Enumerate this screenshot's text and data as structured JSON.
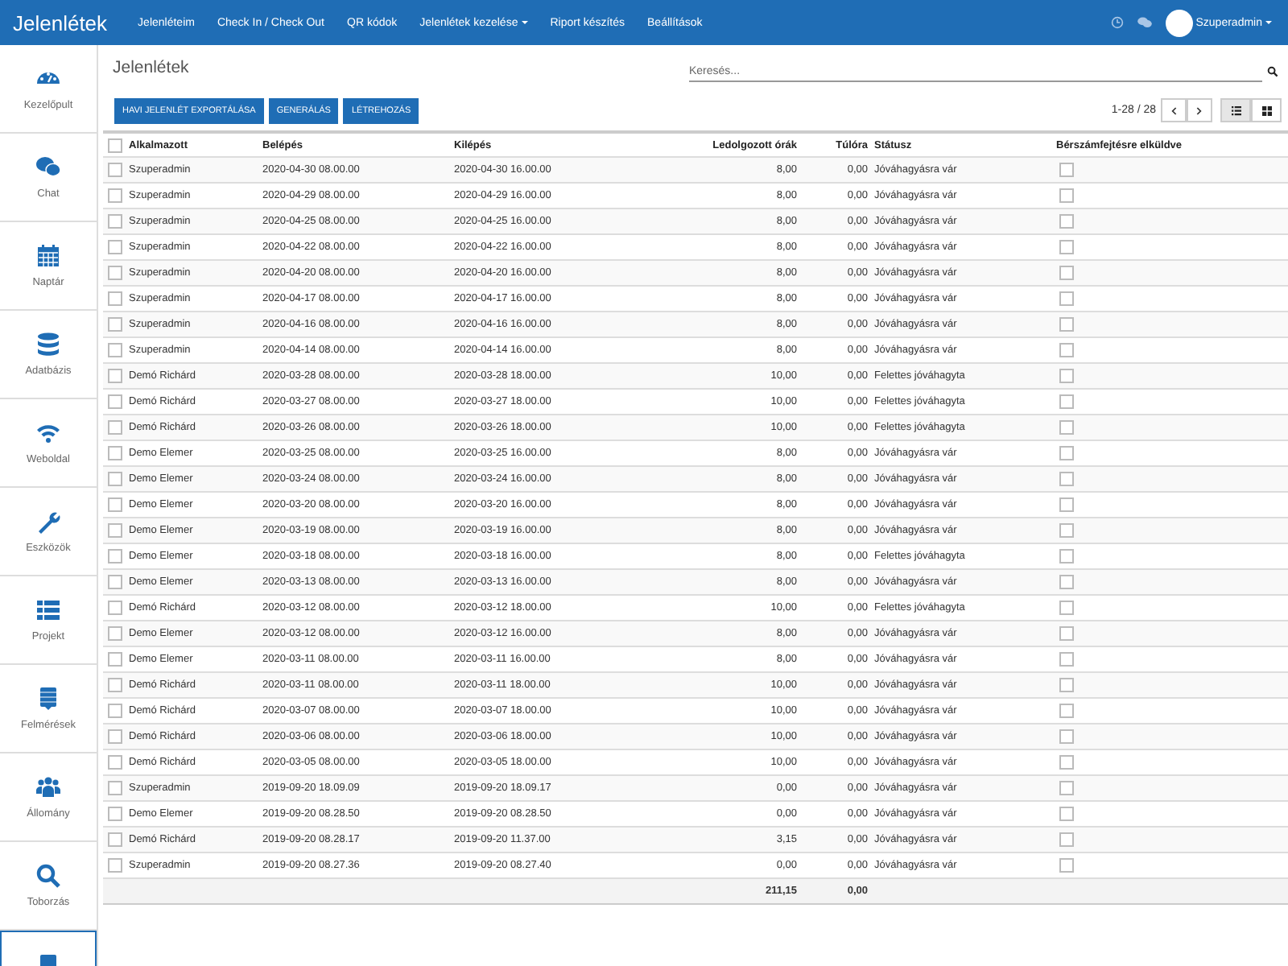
{
  "navbar": {
    "brand": "Jelenlétek",
    "menu": [
      {
        "label": "Jelenléteim",
        "dropdown": false
      },
      {
        "label": "Check In / Check Out",
        "dropdown": false
      },
      {
        "label": "QR kódok",
        "dropdown": false
      },
      {
        "label": "Jelenlétek kezelése",
        "dropdown": true
      },
      {
        "label": "Riport készítés",
        "dropdown": false
      },
      {
        "label": "Beállítások",
        "dropdown": false
      }
    ],
    "user": {
      "name": "Szuperadmin",
      "dropdown": true
    }
  },
  "sidebar": {
    "items": [
      {
        "label": "Kezelőpult",
        "selected": false
      },
      {
        "label": "Chat",
        "selected": false
      },
      {
        "label": "Naptár",
        "selected": false
      },
      {
        "label": "Adatbázis",
        "selected": false
      },
      {
        "label": "Weboldal",
        "selected": false
      },
      {
        "label": "Eszközök",
        "selected": false
      },
      {
        "label": "Projekt",
        "selected": false
      },
      {
        "label": "Felmérések",
        "selected": false
      },
      {
        "label": "Állomány",
        "selected": false
      },
      {
        "label": "Toborzás",
        "selected": false
      },
      {
        "selected": true
      }
    ]
  },
  "page": {
    "title": "Jelenlétek",
    "search": {
      "placeholder": "Keresés..."
    },
    "buttons": [
      "HAVI JELENLÉT EXPORTÁLÁSA",
      "GENERÁLÁS",
      "LÉTREHOZÁS"
    ],
    "pager": {
      "range": "1-28 / 28"
    },
    "view_modes": [
      {
        "selected": true
      },
      {
        "selected": false
      }
    ]
  },
  "table": {
    "select_all": {
      "checked": false
    },
    "columns": [
      "Alkalmazott",
      "Belépés",
      "Kilépés",
      "Ledolgozott órák",
      "Túlóra",
      "Státusz",
      "Bérszámfejtésre elküldve"
    ],
    "rows": [
      {
        "checked": false,
        "employee": "Szuperadmin",
        "check_in": "2020-04-30 08.00.00",
        "check_out": "2020-04-30 16.00.00",
        "hours": "8,00",
        "overtime": "0,00",
        "status": "Jóváhagyásra vár",
        "sent": false
      },
      {
        "checked": false,
        "employee": "Szuperadmin",
        "check_in": "2020-04-29 08.00.00",
        "check_out": "2020-04-29 16.00.00",
        "hours": "8,00",
        "overtime": "0,00",
        "status": "Jóváhagyásra vár",
        "sent": false
      },
      {
        "checked": false,
        "employee": "Szuperadmin",
        "check_in": "2020-04-25 08.00.00",
        "check_out": "2020-04-25 16.00.00",
        "hours": "8,00",
        "overtime": "0,00",
        "status": "Jóváhagyásra vár",
        "sent": false
      },
      {
        "checked": false,
        "employee": "Szuperadmin",
        "check_in": "2020-04-22 08.00.00",
        "check_out": "2020-04-22 16.00.00",
        "hours": "8,00",
        "overtime": "0,00",
        "status": "Jóváhagyásra vár",
        "sent": false
      },
      {
        "checked": false,
        "employee": "Szuperadmin",
        "check_in": "2020-04-20 08.00.00",
        "check_out": "2020-04-20 16.00.00",
        "hours": "8,00",
        "overtime": "0,00",
        "status": "Jóváhagyásra vár",
        "sent": false
      },
      {
        "checked": false,
        "employee": "Szuperadmin",
        "check_in": "2020-04-17 08.00.00",
        "check_out": "2020-04-17 16.00.00",
        "hours": "8,00",
        "overtime": "0,00",
        "status": "Jóváhagyásra vár",
        "sent": false
      },
      {
        "checked": false,
        "employee": "Szuperadmin",
        "check_in": "2020-04-16 08.00.00",
        "check_out": "2020-04-16 16.00.00",
        "hours": "8,00",
        "overtime": "0,00",
        "status": "Jóváhagyásra vár",
        "sent": false
      },
      {
        "checked": false,
        "employee": "Szuperadmin",
        "check_in": "2020-04-14 08.00.00",
        "check_out": "2020-04-14 16.00.00",
        "hours": "8,00",
        "overtime": "0,00",
        "status": "Jóváhagyásra vár",
        "sent": false
      },
      {
        "checked": false,
        "employee": "Demó Richárd",
        "check_in": "2020-03-28 08.00.00",
        "check_out": "2020-03-28 18.00.00",
        "hours": "10,00",
        "overtime": "0,00",
        "status": "Felettes jóváhagyta",
        "sent": false
      },
      {
        "checked": false,
        "employee": "Demó Richárd",
        "check_in": "2020-03-27 08.00.00",
        "check_out": "2020-03-27 18.00.00",
        "hours": "10,00",
        "overtime": "0,00",
        "status": "Felettes jóváhagyta",
        "sent": false
      },
      {
        "checked": false,
        "employee": "Demó Richárd",
        "check_in": "2020-03-26 08.00.00",
        "check_out": "2020-03-26 18.00.00",
        "hours": "10,00",
        "overtime": "0,00",
        "status": "Felettes jóváhagyta",
        "sent": false
      },
      {
        "checked": false,
        "employee": "Demo Elemer",
        "check_in": "2020-03-25 08.00.00",
        "check_out": "2020-03-25 16.00.00",
        "hours": "8,00",
        "overtime": "0,00",
        "status": "Jóváhagyásra vár",
        "sent": false
      },
      {
        "checked": false,
        "employee": "Demo Elemer",
        "check_in": "2020-03-24 08.00.00",
        "check_out": "2020-03-24 16.00.00",
        "hours": "8,00",
        "overtime": "0,00",
        "status": "Jóváhagyásra vár",
        "sent": false
      },
      {
        "checked": false,
        "employee": "Demo Elemer",
        "check_in": "2020-03-20 08.00.00",
        "check_out": "2020-03-20 16.00.00",
        "hours": "8,00",
        "overtime": "0,00",
        "status": "Jóváhagyásra vár",
        "sent": false
      },
      {
        "checked": false,
        "employee": "Demo Elemer",
        "check_in": "2020-03-19 08.00.00",
        "check_out": "2020-03-19 16.00.00",
        "hours": "8,00",
        "overtime": "0,00",
        "status": "Jóváhagyásra vár",
        "sent": false
      },
      {
        "checked": false,
        "employee": "Demo Elemer",
        "check_in": "2020-03-18 08.00.00",
        "check_out": "2020-03-18 16.00.00",
        "hours": "8,00",
        "overtime": "0,00",
        "status": "Felettes jóváhagyta",
        "sent": false
      },
      {
        "checked": false,
        "employee": "Demo Elemer",
        "check_in": "2020-03-13 08.00.00",
        "check_out": "2020-03-13 16.00.00",
        "hours": "8,00",
        "overtime": "0,00",
        "status": "Jóváhagyásra vár",
        "sent": false
      },
      {
        "checked": false,
        "employee": "Demó Richárd",
        "check_in": "2020-03-12 08.00.00",
        "check_out": "2020-03-12 18.00.00",
        "hours": "10,00",
        "overtime": "0,00",
        "status": "Felettes jóváhagyta",
        "sent": false
      },
      {
        "checked": false,
        "employee": "Demo Elemer",
        "check_in": "2020-03-12 08.00.00",
        "check_out": "2020-03-12 16.00.00",
        "hours": "8,00",
        "overtime": "0,00",
        "status": "Jóváhagyásra vár",
        "sent": false
      },
      {
        "checked": false,
        "employee": "Demo Elemer",
        "check_in": "2020-03-11 08.00.00",
        "check_out": "2020-03-11 16.00.00",
        "hours": "8,00",
        "overtime": "0,00",
        "status": "Jóváhagyásra vár",
        "sent": false
      },
      {
        "checked": false,
        "employee": "Demó Richárd",
        "check_in": "2020-03-11 08.00.00",
        "check_out": "2020-03-11 18.00.00",
        "hours": "10,00",
        "overtime": "0,00",
        "status": "Jóváhagyásra vár",
        "sent": false
      },
      {
        "checked": false,
        "employee": "Demó Richárd",
        "check_in": "2020-03-07 08.00.00",
        "check_out": "2020-03-07 18.00.00",
        "hours": "10,00",
        "overtime": "0,00",
        "status": "Jóváhagyásra vár",
        "sent": false
      },
      {
        "checked": false,
        "employee": "Demó Richárd",
        "check_in": "2020-03-06 08.00.00",
        "check_out": "2020-03-06 18.00.00",
        "hours": "10,00",
        "overtime": "0,00",
        "status": "Jóváhagyásra vár",
        "sent": false
      },
      {
        "checked": false,
        "employee": "Demó Richárd",
        "check_in": "2020-03-05 08.00.00",
        "check_out": "2020-03-05 18.00.00",
        "hours": "10,00",
        "overtime": "0,00",
        "status": "Jóváhagyásra vár",
        "sent": false
      },
      {
        "checked": false,
        "employee": "Szuperadmin",
        "check_in": "2019-09-20 18.09.09",
        "check_out": "2019-09-20 18.09.17",
        "hours": "0,00",
        "overtime": "0,00",
        "status": "Jóváhagyásra vár",
        "sent": false
      },
      {
        "checked": false,
        "employee": "Demo Elemer",
        "check_in": "2019-09-20 08.28.50",
        "check_out": "2019-09-20 08.28.50",
        "hours": "0,00",
        "overtime": "0,00",
        "status": "Jóváhagyásra vár",
        "sent": false
      },
      {
        "checked": false,
        "employee": "Demó Richárd",
        "check_in": "2019-09-20 08.28.17",
        "check_out": "2019-09-20 11.37.00",
        "hours": "3,15",
        "overtime": "0,00",
        "status": "Jóváhagyásra vár",
        "sent": false
      },
      {
        "checked": false,
        "employee": "Szuperadmin",
        "check_in": "2019-09-20 08.27.36",
        "check_out": "2019-09-20 08.27.40",
        "hours": "0,00",
        "overtime": "0,00",
        "status": "Jóváhagyásra vár",
        "sent": false
      }
    ],
    "totals": {
      "hours": "211,15",
      "overtime": "0,00"
    }
  }
}
